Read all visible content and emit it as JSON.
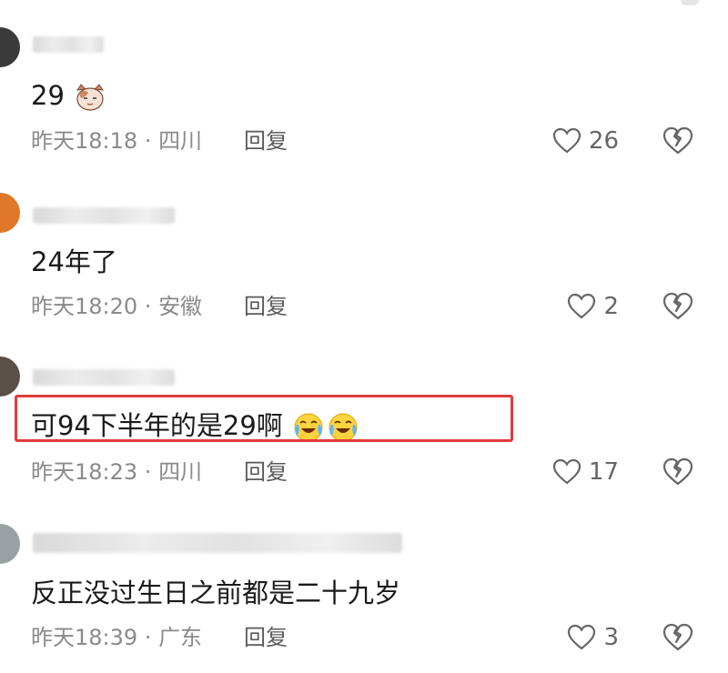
{
  "comments": [
    {
      "text": "29",
      "emoji": "cat-face",
      "time": "昨天18:18",
      "location": "四川",
      "reply_label": "回复",
      "likes": "26"
    },
    {
      "text": "24年了",
      "time": "昨天18:20",
      "location": "安徽",
      "reply_label": "回复",
      "likes": "2"
    },
    {
      "text": "可94下半年的是29啊",
      "emoji": "crying-laughing-face",
      "time": "昨天18:23",
      "location": "四川",
      "reply_label": "回复",
      "likes": "17"
    },
    {
      "text": "反正没过生日之前都是二十九岁",
      "time": "昨天18:39",
      "location": "广东",
      "reply_label": "回复",
      "likes": "3"
    }
  ],
  "separator": " · ",
  "colors": {
    "highlight": "#e23b3b",
    "text": "#1a1a1a",
    "meta": "#8a8a8a"
  }
}
